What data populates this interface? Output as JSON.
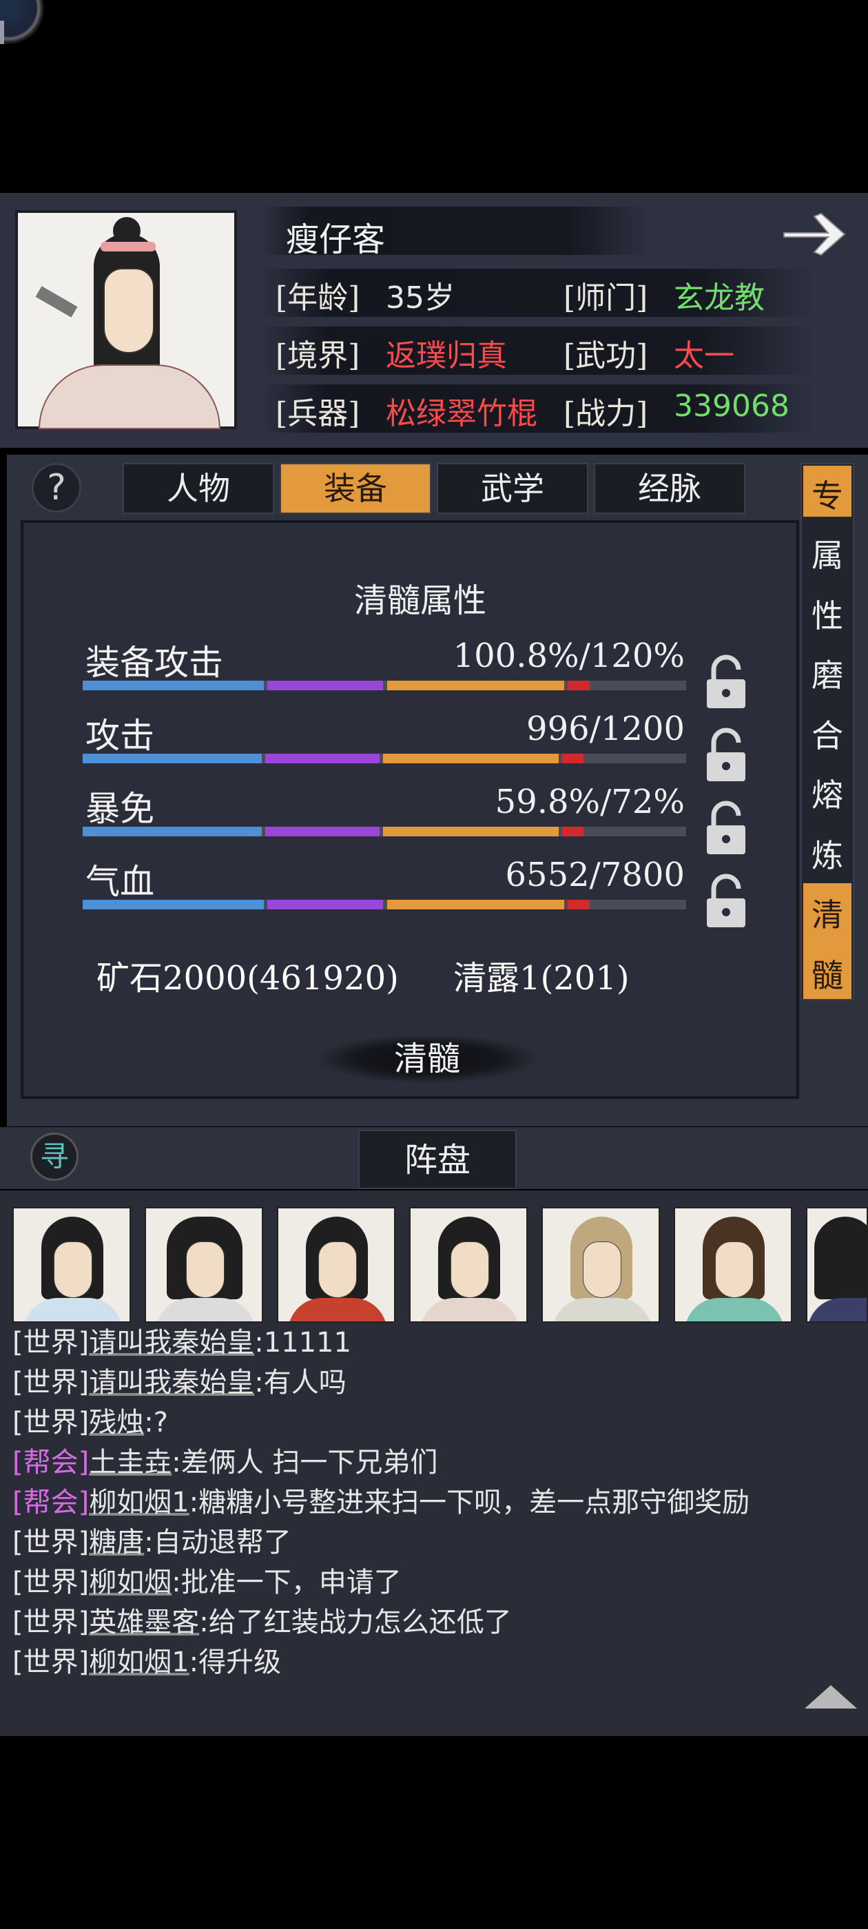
{
  "header": {
    "name": "瘦仔客",
    "stats": [
      {
        "label": "[年龄]",
        "value": "35岁",
        "color": "#e8e8e8"
      },
      {
        "label": "[师门]",
        "value": "玄龙教",
        "color": "#6fe06a"
      },
      {
        "label": "[境界]",
        "value": "返璞归真",
        "color": "#ff4a4a"
      },
      {
        "label": "[武功]",
        "value": "太一",
        "color": "#ff4a4a"
      },
      {
        "label": "[兵器]",
        "value": "松绿翠竹棍",
        "color": "#ff4a4a"
      },
      {
        "label": "[战力]",
        "value": "339068",
        "color": "#6fe06a"
      }
    ]
  },
  "tabs": [
    "人物",
    "装备",
    "武学",
    "经脉"
  ],
  "active_tab": "装备",
  "side_menu": [
    "专",
    "属",
    "性",
    "磨",
    "合",
    "熔",
    "炼",
    "清",
    "髓"
  ],
  "section_title": "清髓属性",
  "attributes": [
    {
      "label": "装备攻击",
      "value": "100.8%/120%",
      "fill": 0.84
    },
    {
      "label": "攻击",
      "value": "996/1200",
      "fill": 0.83
    },
    {
      "label": "暴免",
      "value": "59.8%/72%",
      "fill": 0.83
    },
    {
      "label": "气血",
      "value": "6552/7800",
      "fill": 0.84
    }
  ],
  "resources": {
    "ore": "矿石2000(461920)",
    "dew": "清露1(201)"
  },
  "refine_button": "清髓",
  "formation_button": "阵盘",
  "seek_icon": "寻",
  "colors": {
    "accent": "#e39a3c",
    "guild": "#d96ae6",
    "green": "#6fe06a",
    "red": "#ff4a4a"
  },
  "chat": [
    {
      "channel": "[世界]",
      "type": "world",
      "name": "请叫我秦始皇",
      "msg": ":11111"
    },
    {
      "channel": "[世界]",
      "type": "world",
      "name": "请叫我秦始皇",
      "msg": ":有人吗"
    },
    {
      "channel": "[世界]",
      "type": "world",
      "name": "残烛",
      "msg": ":?"
    },
    {
      "channel": "[帮会]",
      "type": "guild",
      "name": "土圭垚",
      "msg": ":差俩人 扫一下兄弟们"
    },
    {
      "channel": "[帮会]",
      "type": "guild",
      "name": "柳如烟1",
      "msg": ":糖糖小号整进来扫一下呗，差一点那守御奖励"
    },
    {
      "channel": "[世界]",
      "type": "world",
      "name": "糖唐",
      "msg": ":自动退帮了"
    },
    {
      "channel": "[世界]",
      "type": "world",
      "name": "柳如烟",
      "msg": ":批准一下，申请了"
    },
    {
      "channel": "[世界]",
      "type": "world",
      "name": "英雄墨客",
      "msg": ":给了红装战力怎么还低了"
    },
    {
      "channel": "[世界]",
      "type": "world",
      "name": "柳如烟1",
      "msg": ":得升级"
    }
  ]
}
